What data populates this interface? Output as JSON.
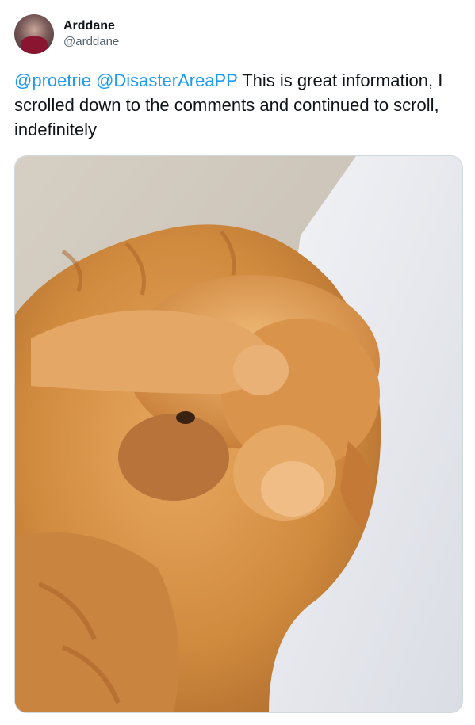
{
  "author": {
    "display_name": "Arddane",
    "handle": "@arddane"
  },
  "tweet": {
    "mentions": [
      "@proetrie",
      "@DisasterAreaPP"
    ],
    "body": "This is great information, I scrolled down to the comments and continued to scroll, indefinitely"
  },
  "colors": {
    "link": "#1d9bf0",
    "text": "#0f1419",
    "secondary": "#536471"
  },
  "media": {
    "icon": "photo-cat-facepalm"
  }
}
